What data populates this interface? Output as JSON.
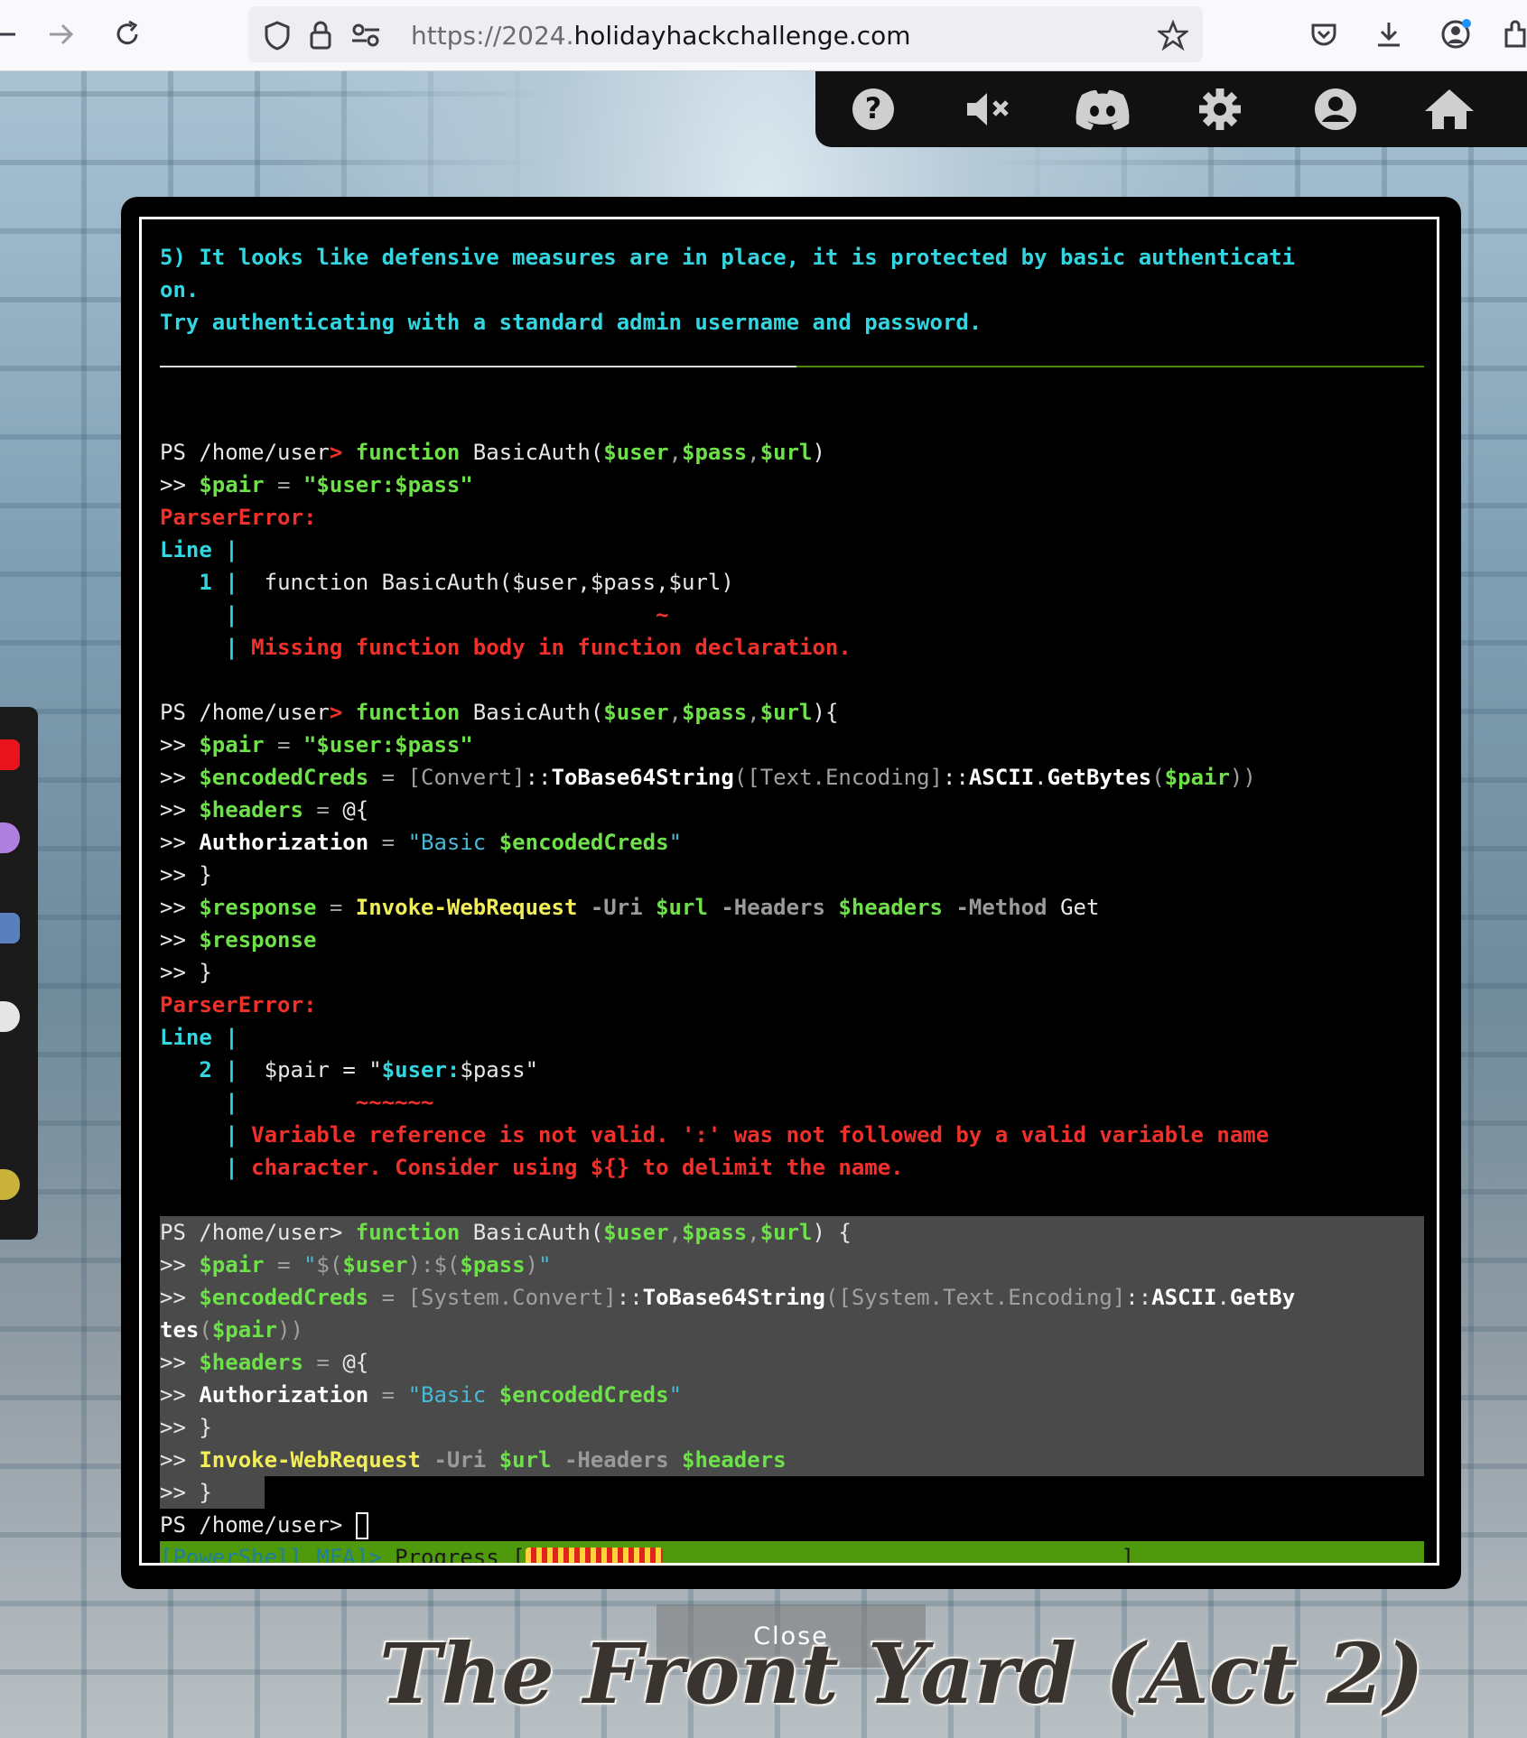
{
  "browser": {
    "url_prefix": "https://2024.",
    "url_domain": "holidayhackchallenge.com"
  },
  "toolbar_icons": [
    "help-icon",
    "mute-icon",
    "discord-icon",
    "settings-icon",
    "profile-icon",
    "home-icon"
  ],
  "terminal": {
    "challenge": {
      "line1": "5) It looks like defensive measures are in place, it is protected by basic authenticati",
      "line2": "on.",
      "line3": "Try authenticating with a standard admin username and password."
    },
    "prompt": "PS /home/user",
    "cont": ">> ",
    "block1": {
      "kw_function": "function",
      "fn_name": "BasicAuth",
      "arg_user": "$user",
      "arg_pass": "$pass",
      "arg_url": "$url",
      "pair_var": "$pair",
      "pair_value": "\"$user:$pass\"",
      "error_title": "ParserError:",
      "line_label": "Line",
      "line_num": "1",
      "source": "function BasicAuth($user,$pass,$url)",
      "marker": "~",
      "message": "Missing function body in function declaration."
    },
    "block2": {
      "enc_var": "$encodedCreds",
      "convert": "[Convert]",
      "tobase64": "ToBase64String",
      "encoding": "[Text.Encoding]",
      "ascii": "ASCII",
      "getbytes": "GetBytes",
      "headers_var": "$headers",
      "hash_open": "@{",
      "auth_key": "Authorization",
      "basic": "\"Basic ",
      "close_brace": "}",
      "response_var": "$response",
      "iwr": "Invoke-WebRequest",
      "p_uri": "-Uri",
      "p_headers": "-Headers",
      "p_method": "-Method",
      "method_val": "Get",
      "line_num": "2",
      "marker": "~~~~~~",
      "msg1": "Variable reference is not valid. ':' was not followed by a valid variable name",
      "msg2": "character. Consider using ${} to delimit the name."
    },
    "block3": {
      "sys_convert": "[System.Convert]",
      "sys_encoding": "[System.Text.Encoding]",
      "getby": "GetBy",
      "tes": "tes"
    },
    "progress": {
      "tag": "[PowerShell MFA]>",
      "label": " Progress [",
      "end": "]",
      "fraction": 0.23
    }
  },
  "close_label": "Close",
  "scene_title": "The Front Yard (Act 2)"
}
